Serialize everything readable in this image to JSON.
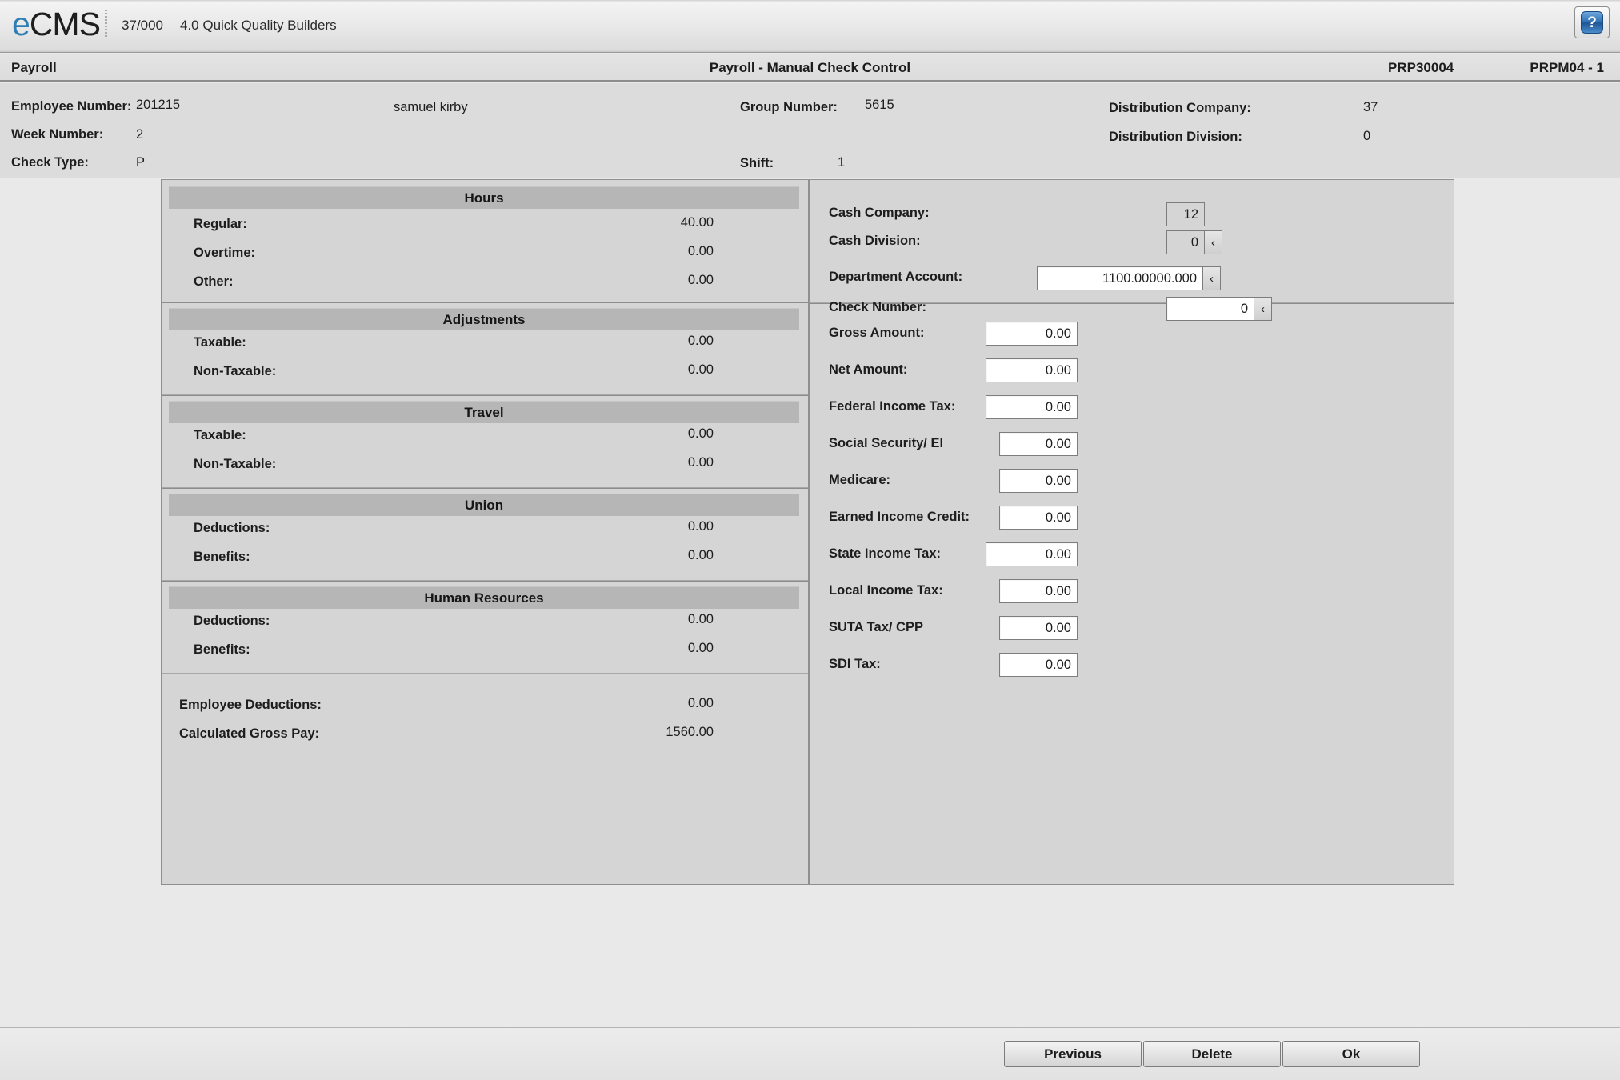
{
  "brand": {
    "logo_e": "e",
    "logo_cms": "CMS",
    "context_number": "37/000",
    "context_name": "4.0 Quick Quality Builders",
    "help_icon": "question-mark-icon",
    "help_glyph": "?",
    "accent_blue": "#2f7fb5"
  },
  "title_strip": {
    "module": "Payroll",
    "screen_title": "Payroll - Manual Check Control",
    "program_id": "PRP30004",
    "screen_id": "PRPM04 - 1"
  },
  "header_info": {
    "employee_number_label": "Employee Number:",
    "employee_number_value": "201215",
    "employee_name": "samuel kirby",
    "week_number_label": "Week Number:",
    "week_number_value": "2",
    "check_type_label": "Check Type:",
    "check_type_value": "P",
    "group_number_label": "Group Number:",
    "group_number_value": "5615",
    "shift_label": "Shift:",
    "shift_value": "1",
    "distribution_company_label": "Distribution Company:",
    "distribution_company_value": "37",
    "distribution_division_label": "Distribution Division:",
    "distribution_division_value": "0"
  },
  "left_panel": {
    "sections": [
      {
        "title": "Hours",
        "rows": [
          {
            "label": "Regular:",
            "value": "40.00"
          },
          {
            "label": "Overtime:",
            "value": "0.00"
          },
          {
            "label": "Other:",
            "value": "0.00"
          }
        ]
      },
      {
        "title": "Adjustments",
        "rows": [
          {
            "label": "Taxable:",
            "value": "0.00"
          },
          {
            "label": "Non-Taxable:",
            "value": "0.00"
          }
        ]
      },
      {
        "title": "Travel",
        "rows": [
          {
            "label": "Taxable:",
            "value": "0.00"
          },
          {
            "label": "Non-Taxable:",
            "value": "0.00"
          }
        ]
      },
      {
        "title": "Union",
        "rows": [
          {
            "label": "Deductions:",
            "value": "0.00"
          },
          {
            "label": "Benefits:",
            "value": "0.00"
          }
        ]
      },
      {
        "title": "Human Resources",
        "rows": [
          {
            "label": "Deductions:",
            "value": "0.00"
          },
          {
            "label": "Benefits:",
            "value": "0.00"
          }
        ]
      }
    ],
    "totals": [
      {
        "label": "Employee Deductions:",
        "value": "0.00"
      },
      {
        "label": "Calculated Gross Pay:",
        "value": "1560.00"
      }
    ]
  },
  "right_panel": {
    "account_fields": [
      {
        "label": "Cash Company:",
        "value": "12",
        "disabled": true,
        "lookup": false
      },
      {
        "label": "Cash Division:",
        "value": "0",
        "disabled": true,
        "lookup": true
      },
      {
        "label": "Department Account:",
        "value": "1100.00000.000",
        "disabled": false,
        "lookup": true
      },
      {
        "label": "Check Number:",
        "value": "0",
        "disabled": false,
        "lookup": true
      }
    ],
    "amount_fields": [
      {
        "label": "Gross Amount:",
        "value": "0.00"
      },
      {
        "label": "Net Amount:",
        "value": "0.00"
      },
      {
        "label": "Federal Income Tax:",
        "value": "0.00"
      },
      {
        "label": "Social Security/ EI",
        "value": "0.00"
      },
      {
        "label": "Medicare:",
        "value": "0.00"
      },
      {
        "label": "Earned Income Credit:",
        "value": "0.00"
      },
      {
        "label": "State Income Tax:",
        "value": "0.00"
      },
      {
        "label": "Local Income Tax:",
        "value": "0.00"
      },
      {
        "label": "SUTA Tax/ CPP",
        "value": "0.00"
      },
      {
        "label": "SDI Tax:",
        "value": "0.00"
      }
    ]
  },
  "buttons": {
    "previous": "Previous",
    "delete": "Delete",
    "ok": "Ok"
  }
}
